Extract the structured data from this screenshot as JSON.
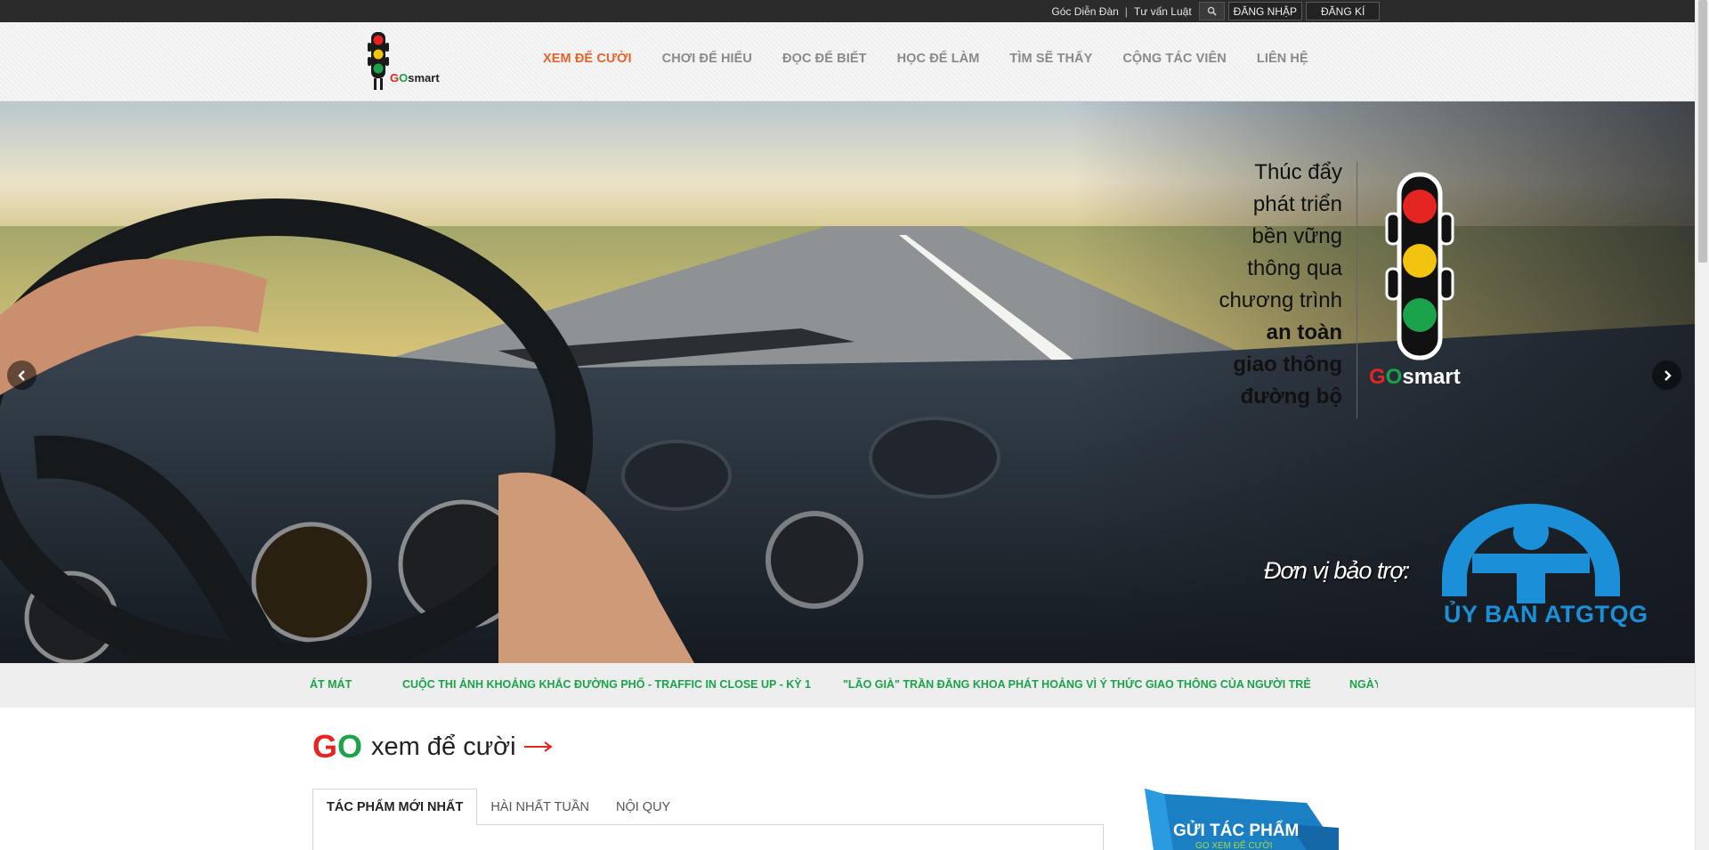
{
  "topbar": {
    "forum_link": "Góc Diễn Đàn",
    "separator": "|",
    "legal_link": "Tư vấn Luật",
    "login": "ĐĂNG NHẬP",
    "register": "ĐĂNG KÍ"
  },
  "header": {
    "logo_g": "G",
    "logo_o": "O",
    "logo_rest": "smart",
    "nav": [
      {
        "label": "XEM ĐỂ CƯỜI"
      },
      {
        "label": "CHƠI ĐỂ HIỂU"
      },
      {
        "label": "ĐỌC ĐỂ BIẾT"
      },
      {
        "label": "HỌC ĐỂ LÀM"
      },
      {
        "label": "TÌM SẼ THẤY"
      },
      {
        "label": "CỘNG TÁC VIÊN"
      },
      {
        "label": "LIÊN HỆ"
      }
    ]
  },
  "hero": {
    "slogan": [
      "Thúc đẩy",
      "phát triển",
      "bền vững",
      "thông qua",
      "chương trình",
      "an toàn",
      "giao thông",
      "đường bộ"
    ],
    "brand_g": "G",
    "brand_o": "O",
    "brand_rest": "smart",
    "sponsor_label": "Đơn vị bảo trợ:",
    "sponsor_name": "ỦY BAN ATGTQG"
  },
  "ticker": {
    "items": [
      "ÁT MÁT",
      "CUỘC THI ẢNH KHOẢNG KHẮC ĐƯỜNG PHỐ - TRAFFIC IN CLOSE UP - KỲ 1",
      "\"LÃO GIÀ\" TRẦN ĐĂNG KHOA PHÁT HOẢNG VÌ Ý THỨC GIAO THÔNG CỦA NGƯỜI TRẺ",
      "NGÀY"
    ]
  },
  "section": {
    "title_g": "G",
    "title_o": "O",
    "title_rest": "xem để cười",
    "tabs": [
      {
        "label": "TÁC PHẨM MỚI NHẤT"
      },
      {
        "label": "HÀI NHẤT TUẦN"
      },
      {
        "label": "NỘI QUY"
      }
    ],
    "submit_label": "GỬI TÁC PHẨM",
    "submit_sub": "GO XEM ĐỂ CƯỜI"
  },
  "colors": {
    "accent": "#e8622a",
    "brand_red": "#e52521",
    "brand_green": "#1aa34a",
    "sponsor_blue": "#1b8fd8"
  }
}
